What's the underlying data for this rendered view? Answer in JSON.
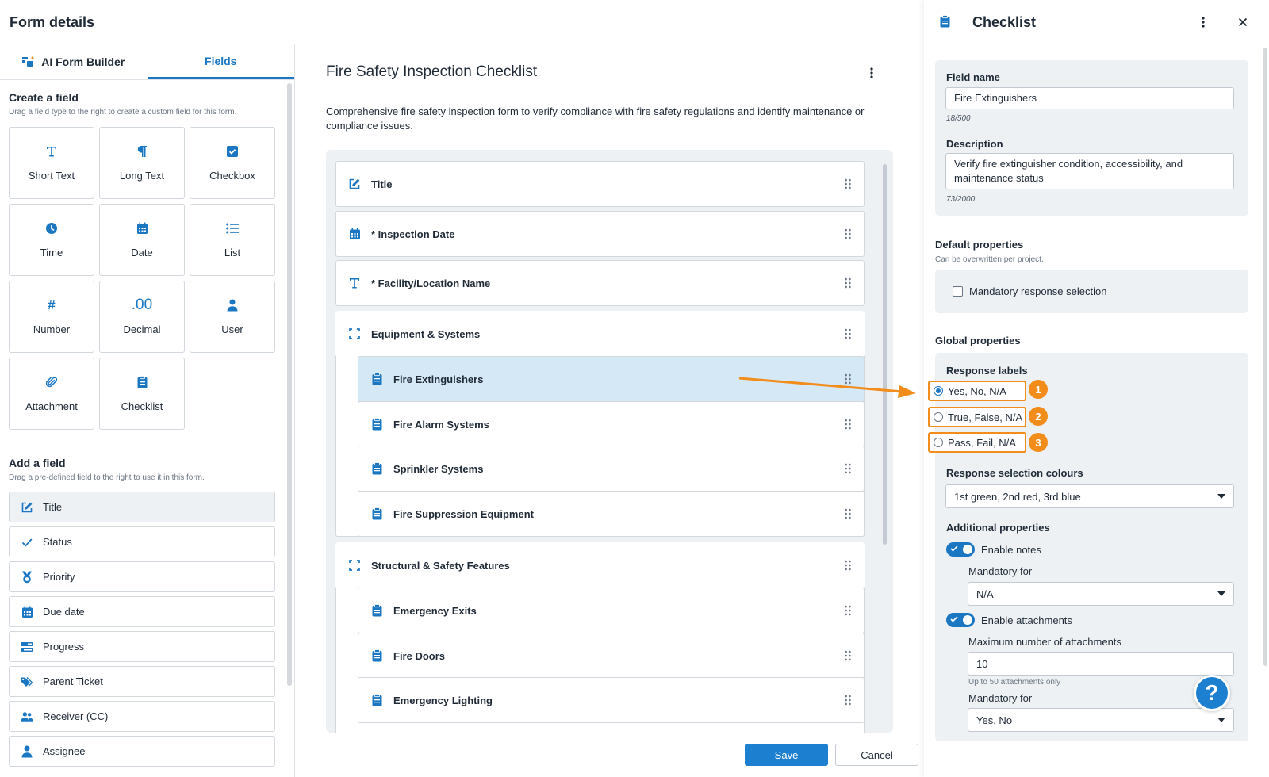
{
  "header": {
    "title": "Form details"
  },
  "left": {
    "tabs": [
      {
        "label": "AI Form Builder"
      },
      {
        "label": "Fields"
      }
    ],
    "create": {
      "title": "Create a field",
      "subtitle": "Drag a field type to the right to create a custom field for this form.",
      "types": [
        {
          "label": "Short Text",
          "icon": "text-t-icon"
        },
        {
          "label": "Long Text",
          "icon": "pilcrow-icon"
        },
        {
          "label": "Checkbox",
          "icon": "checkbox-icon"
        },
        {
          "label": "Time",
          "icon": "clock-icon"
        },
        {
          "label": "Date",
          "icon": "calendar-icon"
        },
        {
          "label": "List",
          "icon": "list-icon"
        },
        {
          "label": "Number",
          "icon": "hash-icon",
          "glyph": "#"
        },
        {
          "label": "Decimal",
          "icon": "decimal-icon",
          "glyph": ".00"
        },
        {
          "label": "User",
          "icon": "user-icon"
        },
        {
          "label": "Attachment",
          "icon": "paperclip-icon"
        },
        {
          "label": "Checklist",
          "icon": "clipboard-icon"
        }
      ]
    },
    "add": {
      "title": "Add a field",
      "subtitle": "Drag a pre-defined field to the right to use it in this form.",
      "items": [
        {
          "label": "Title",
          "icon": "edit-icon"
        },
        {
          "label": "Status",
          "icon": "check-icon"
        },
        {
          "label": "Priority",
          "icon": "medal-icon"
        },
        {
          "label": "Due date",
          "icon": "calendar-icon"
        },
        {
          "label": "Progress",
          "icon": "progress-icon"
        },
        {
          "label": "Parent Ticket",
          "icon": "tag-icon"
        },
        {
          "label": "Receiver (CC)",
          "icon": "users-icon"
        },
        {
          "label": "Assignee",
          "icon": "user-icon"
        }
      ]
    }
  },
  "form": {
    "title": "Fire Safety Inspection Checklist",
    "description": "Comprehensive fire safety inspection form to verify compliance with fire safety regulations and identify maintenance or compliance issues.",
    "rows": [
      {
        "label": "Title",
        "icon": "edit-icon"
      },
      {
        "label": "* Inspection Date",
        "icon": "calendar-icon"
      },
      {
        "label": "* Facility/Location Name",
        "icon": "text-t-icon"
      },
      {
        "label": "Equipment & Systems",
        "icon": "group-frame-icon"
      },
      {
        "label": "Fire Extinguishers",
        "icon": "clipboard-icon"
      },
      {
        "label": "Fire Alarm Systems",
        "icon": "clipboard-icon"
      },
      {
        "label": "Sprinkler Systems",
        "icon": "clipboard-icon"
      },
      {
        "label": "Fire Suppression Equipment",
        "icon": "clipboard-icon"
      },
      {
        "label": "Structural & Safety Features",
        "icon": "group-frame-icon"
      },
      {
        "label": "Emergency Exits",
        "icon": "clipboard-icon"
      },
      {
        "label": "Fire Doors",
        "icon": "clipboard-icon"
      },
      {
        "label": "Emergency Lighting",
        "icon": "clipboard-icon"
      }
    ],
    "save_label": "Save",
    "cancel_label": "Cancel"
  },
  "panel": {
    "title": "Checklist",
    "field_name_label": "Field name",
    "field_name_value": "Fire Extinguishers",
    "field_name_count": "18/500",
    "description_label": "Description",
    "description_value": "Verify fire extinguisher condition, accessibility, and maintenance status",
    "description_count": "73/2000",
    "default_title": "Default properties",
    "default_sub": "Can be overwritten per project.",
    "mandatory_label": "Mandatory response selection",
    "global_title": "Global properties",
    "response_labels_title": "Response labels",
    "response_options": [
      {
        "label": "Yes, No, N/A",
        "selected": true,
        "badge": "1"
      },
      {
        "label": "True, False, N/A",
        "selected": false,
        "badge": "2"
      },
      {
        "label": "Pass, Fail, N/A",
        "selected": false,
        "badge": "3"
      }
    ],
    "colours_title": "Response selection colours",
    "colours_value": "1st green, 2nd red, 3rd blue",
    "additional_title": "Additional properties",
    "enable_notes": "Enable notes",
    "notes_mandatory_label": "Mandatory for",
    "notes_mandatory_value": "N/A",
    "enable_attachments": "Enable attachments",
    "max_attach_label": "Maximum number of attachments",
    "max_attach_value": "10",
    "max_attach_hint": "Up to 50 attachments only",
    "attach_mandatory_label": "Mandatory for",
    "attach_mandatory_value": "Yes, No",
    "help_glyph": "?"
  },
  "colors": {
    "accent": "#1c77c3",
    "highlight": "#f28c1a",
    "selected_row": "#d5e8f6"
  }
}
